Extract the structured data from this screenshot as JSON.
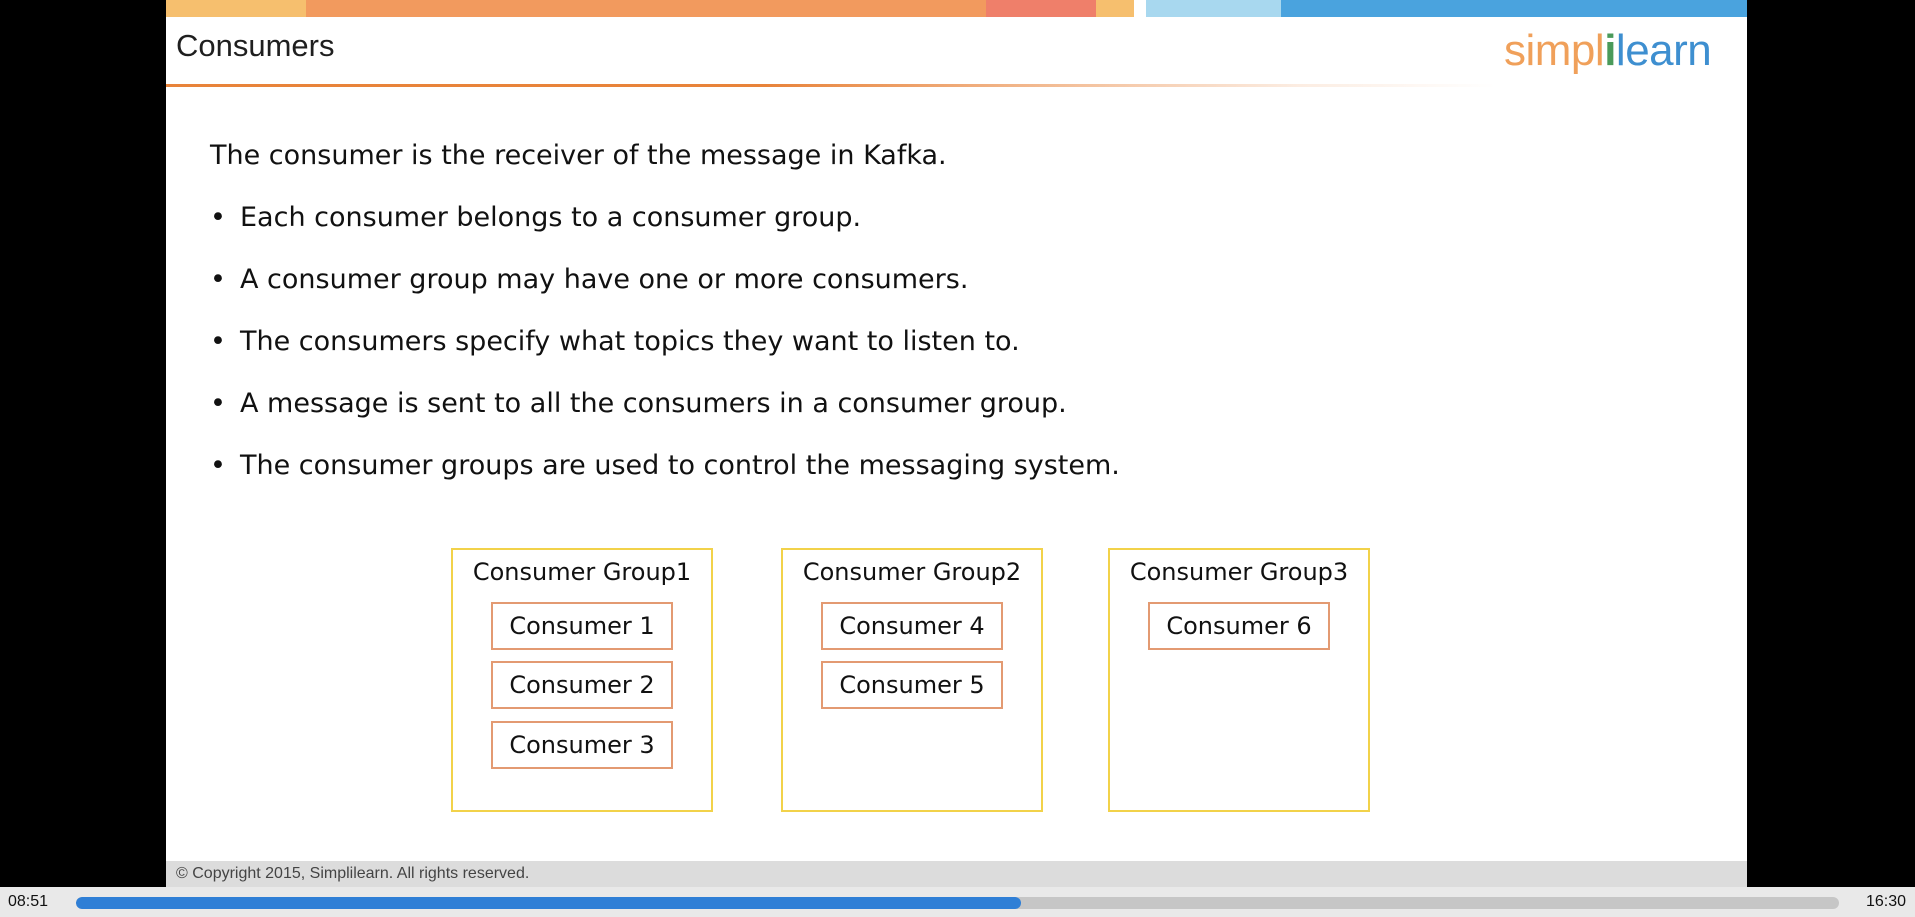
{
  "slide": {
    "title": "Consumers",
    "logo": {
      "part1": "simpl",
      "separator": "i",
      "part2": "learn"
    },
    "intro": "The consumer is the receiver of the message in Kafka.",
    "bullets": [
      "Each consumer belongs to a consumer group.",
      "A consumer group may have one or more consumers.",
      "The consumers specify what topics they want to listen to.",
      "A message is sent to all the consumers in a consumer group.",
      "The consumer groups are used to control the messaging system."
    ],
    "groups": [
      {
        "title": "Consumer Group1",
        "consumers": [
          "Consumer 1",
          "Consumer 2",
          "Consumer 3"
        ]
      },
      {
        "title": "Consumer Group2",
        "consumers": [
          "Consumer 4",
          "Consumer 5"
        ]
      },
      {
        "title": "Consumer Group3",
        "consumers": [
          "Consumer 6"
        ]
      }
    ],
    "footer": "© Copyright 2015, Simplilearn. All rights reserved.",
    "colors": {
      "group_border": "#f2d24a",
      "consumer_border": "#e39a72",
      "title_rule": "#e8833a",
      "topbar": [
        "#f6bf6e",
        "#f29a5e",
        "#ef7f6a",
        "#f6bf6e",
        "#a8d8ef",
        "#4aa3de"
      ]
    }
  },
  "player": {
    "time_current": "08:51",
    "time_total": "16:30",
    "progress": 0.536
  }
}
